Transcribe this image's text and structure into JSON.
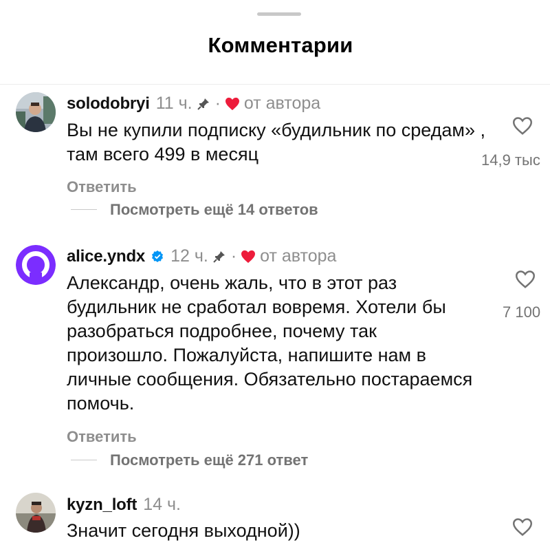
{
  "header": {
    "title": "Комментарии"
  },
  "comments": [
    {
      "username": "solodobryi",
      "time": "11 ч.",
      "separator": "·",
      "by_author": "от автора",
      "text": "Вы не купили подписку «будильник по средам» , там всего 499 в месяц",
      "likes": "14,9 тыс",
      "reply_label": "Ответить",
      "view_more": "Посмотреть ещё 14 ответов",
      "pinned": true,
      "liked_by_author": true
    },
    {
      "username": "alice.yndx",
      "verified": true,
      "time": "12 ч.",
      "separator": "·",
      "by_author": "от автора",
      "text": "Александр, очень жаль, что в этот раз будильник не сработал вовремя. Хотели бы разобраться подробнее, почему так произошло. Пожалуйста, напишите нам в личные сообщения. Обязательно постараемся помочь.",
      "likes": "7 100",
      "reply_label": "Ответить",
      "view_more": "Посмотреть ещё 271 ответ",
      "pinned": true,
      "liked_by_author": true
    },
    {
      "username": "kyzn_loft",
      "time": "14 ч.",
      "text": "Значит сегодня выходной))"
    }
  ],
  "colors": {
    "heart_red": "#ed1c3b",
    "verified_blue": "#0095f6",
    "alice_purple": "#7b2dff",
    "secondary_text": "#8e8e8e"
  }
}
